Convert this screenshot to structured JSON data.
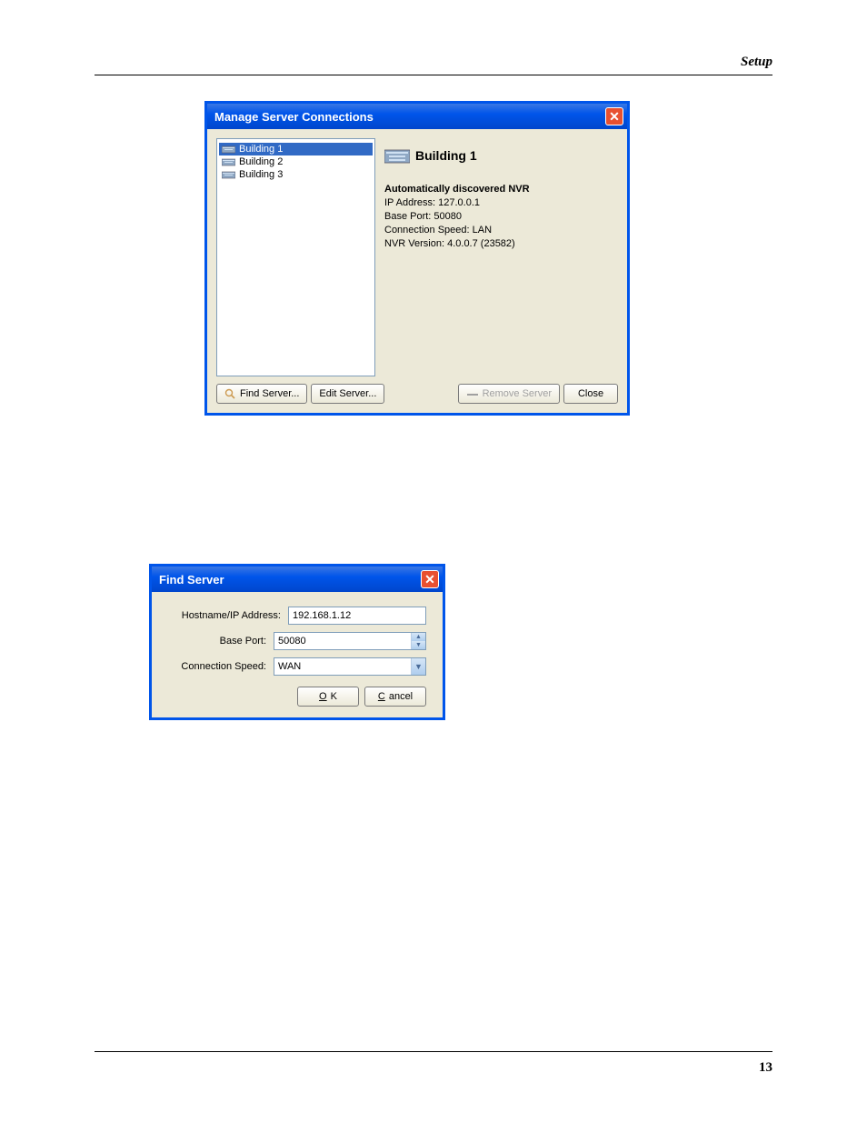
{
  "page": {
    "header": "Setup",
    "number": "13"
  },
  "manage_dialog": {
    "title": "Manage Server Connections",
    "servers": [
      "Building 1",
      "Building 2",
      "Building 3"
    ],
    "selected": "Building 1",
    "details": {
      "heading": "Automatically discovered NVR",
      "ip_label": "IP Address:",
      "ip": "127.0.0.1",
      "port_label": "Base Port:",
      "port": "50080",
      "speed_label": "Connection Speed:",
      "speed": "LAN",
      "version_label": "NVR Version:",
      "version": "4.0.0.7 (23582)"
    },
    "buttons": {
      "find": "Find Server...",
      "edit": "Edit Server...",
      "remove": "Remove Server",
      "close": "Close"
    }
  },
  "find_dialog": {
    "title": "Find Server",
    "fields": {
      "hostname_label": "Hostname/IP Address:",
      "hostname_value": "192.168.1.12",
      "port_label": "Base Port:",
      "port_value": "50080",
      "speed_label": "Connection Speed:",
      "speed_value": "WAN"
    },
    "buttons": {
      "ok": "OK",
      "cancel": "Cancel"
    }
  }
}
